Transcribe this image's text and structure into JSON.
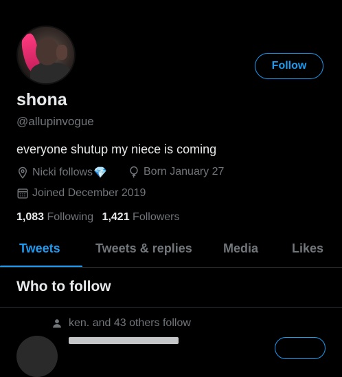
{
  "profile": {
    "name": "shona",
    "handle": "@allupinvogue",
    "bio": "everyone shutup my niece is coming",
    "location": "Nicki follows",
    "location_emoji": "💎",
    "birthday": "Born January 27",
    "joined": "Joined December 2019",
    "following_count": "1,083",
    "following_label": "Following",
    "followers_count": "1,421",
    "followers_label": "Followers"
  },
  "actions": {
    "follow_label": "Follow"
  },
  "tabs": [
    {
      "label": "Tweets",
      "active": true
    },
    {
      "label": "Tweets & replies",
      "active": false
    },
    {
      "label": "Media",
      "active": false
    },
    {
      "label": "Likes",
      "active": false
    }
  ],
  "who_to_follow": {
    "heading": "Who to follow",
    "social_context": "ken. and 43 others follow"
  },
  "colors": {
    "accent": "#1d9bf0",
    "background": "#000000",
    "muted": "#71767b",
    "text": "#e7e9ea"
  },
  "icons": [
    "location-icon",
    "balloon-icon",
    "calendar-icon",
    "person-icon"
  ]
}
